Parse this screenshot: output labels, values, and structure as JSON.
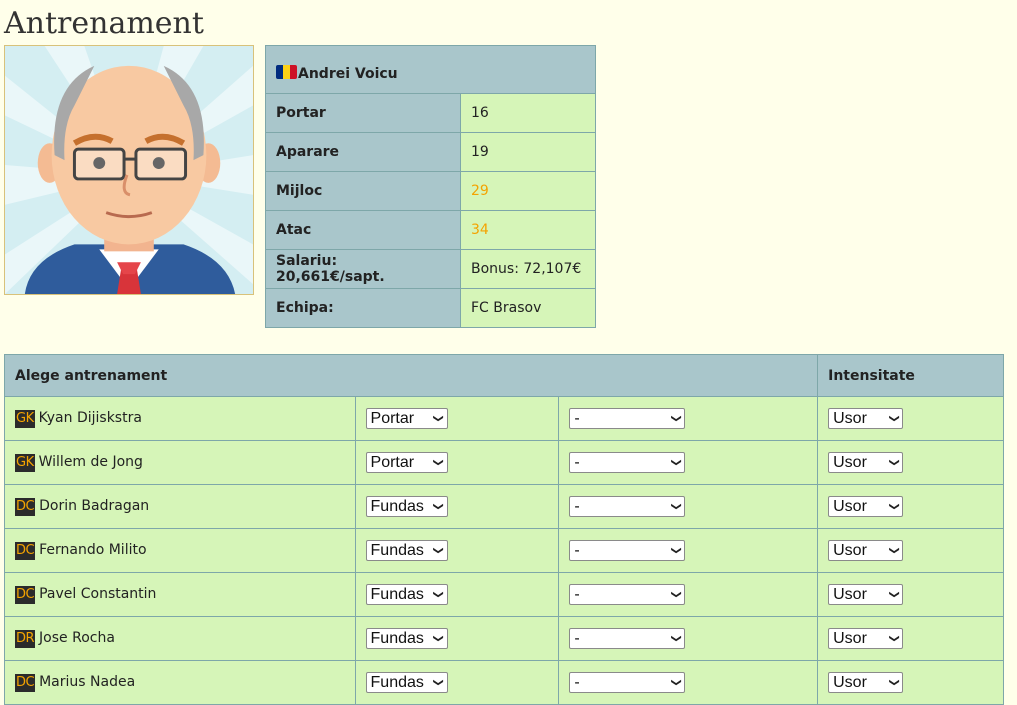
{
  "page": {
    "title": "Antrenament"
  },
  "coach": {
    "name": "Andrei Voicu",
    "flag_colors": [
      "#002B7F",
      "#FCD116",
      "#CE1126"
    ],
    "stats": [
      {
        "label": "Portar",
        "value": "16",
        "highlight": false
      },
      {
        "label": "Aparare",
        "value": "19",
        "highlight": false
      },
      {
        "label": "Mijloc",
        "value": "29",
        "highlight": true
      },
      {
        "label": "Atac",
        "value": "34",
        "highlight": true
      }
    ],
    "salary": "Salariu: 20,661€/sapt.",
    "bonus": "Bonus: 72,107€",
    "team_label": "Echipa:",
    "team": "FC Brasov"
  },
  "training": {
    "header_label": "Alege antrenament",
    "intensity_header": "Intensitate",
    "rows": [
      {
        "pos": "GK",
        "name": "Kyan Dijiskstra",
        "type": "Portar",
        "sub": "-",
        "intensity": "Usor"
      },
      {
        "pos": "GK",
        "name": "Willem de Jong",
        "type": "Portar",
        "sub": "-",
        "intensity": "Usor"
      },
      {
        "pos": "DC",
        "name": "Dorin Badragan",
        "type": "Fundas",
        "sub": "-",
        "intensity": "Usor"
      },
      {
        "pos": "DC",
        "name": "Fernando Milito",
        "type": "Fundas",
        "sub": "-",
        "intensity": "Usor"
      },
      {
        "pos": "DC",
        "name": "Pavel Constantin",
        "type": "Fundas",
        "sub": "-",
        "intensity": "Usor"
      },
      {
        "pos": "DR",
        "name": "Jose Rocha",
        "type": "Fundas",
        "sub": "-",
        "intensity": "Usor"
      },
      {
        "pos": "DC",
        "name": "Marius Nadea",
        "type": "Fundas",
        "sub": "-",
        "intensity": "Usor"
      }
    ]
  }
}
